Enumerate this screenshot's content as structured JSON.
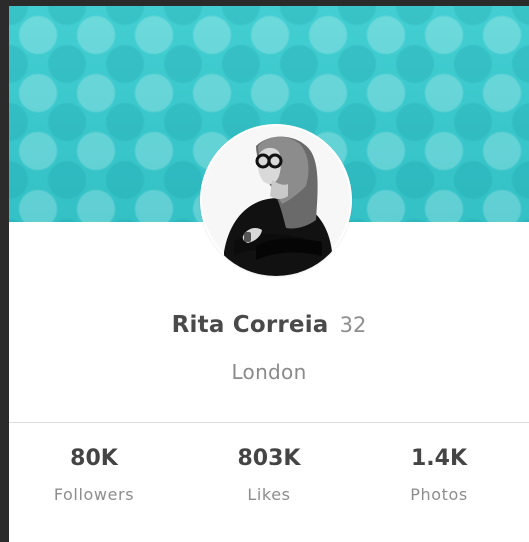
{
  "profile": {
    "name": "Rita Correia",
    "age": "32",
    "location": "London"
  },
  "stats": [
    {
      "value": "80K",
      "label": "Followers"
    },
    {
      "value": "803K",
      "label": "Likes"
    },
    {
      "value": "1.4K",
      "label": "Photos"
    }
  ],
  "colors": {
    "banner": "#38c6ca",
    "card": "#ffffff",
    "text": "#4a4a4a",
    "muted": "#8a8a8a",
    "frame": "#2b2b2b"
  }
}
